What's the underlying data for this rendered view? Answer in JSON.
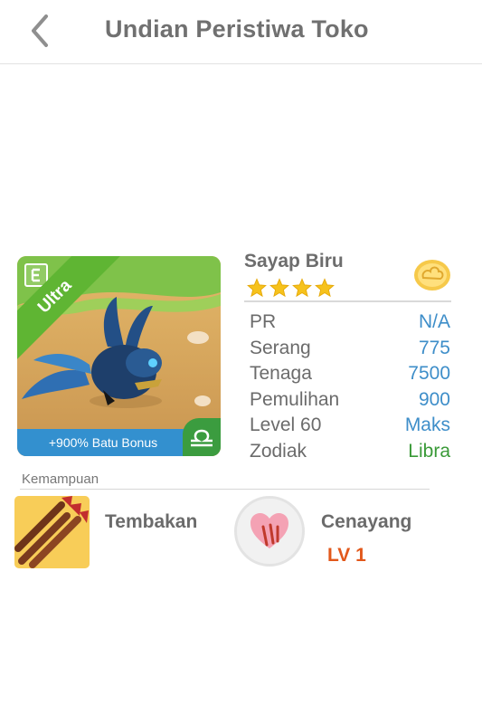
{
  "header": {
    "title": "Undian Peristiwa Toko",
    "back_icon": "chevron-left-icon"
  },
  "pet_card": {
    "edition_icon": "e-badge-icon",
    "rarity": "Ultra",
    "bonus_text": "+900% Batu Bonus",
    "zodiac_icon": "libra-icon",
    "colors": {
      "ribbon": "#5fb533",
      "bonus_bar": "#3390cf",
      "zodiac_corner": "#3b9c3f"
    }
  },
  "pet": {
    "name": "Sayap Biru",
    "stars": 4,
    "currency_icon": "cloud-coin-icon",
    "stats": [
      {
        "label": "PR",
        "value": "N/A"
      },
      {
        "label": "Serang",
        "value": "775"
      },
      {
        "label": "Tenaga",
        "value": "7500"
      },
      {
        "label": "Pemulihan",
        "value": "900"
      },
      {
        "label": "Level 60",
        "value": "Maks"
      },
      {
        "label": "Zodiak",
        "value": "Libra"
      }
    ]
  },
  "abilities": {
    "section_label": "Kemampuan",
    "items": [
      {
        "name": "Tembakan",
        "icon": "triple-arrow-icon"
      },
      {
        "name": "Cenayang",
        "icon": "pink-heart-claw-icon",
        "level": "LV 1"
      }
    ]
  }
}
